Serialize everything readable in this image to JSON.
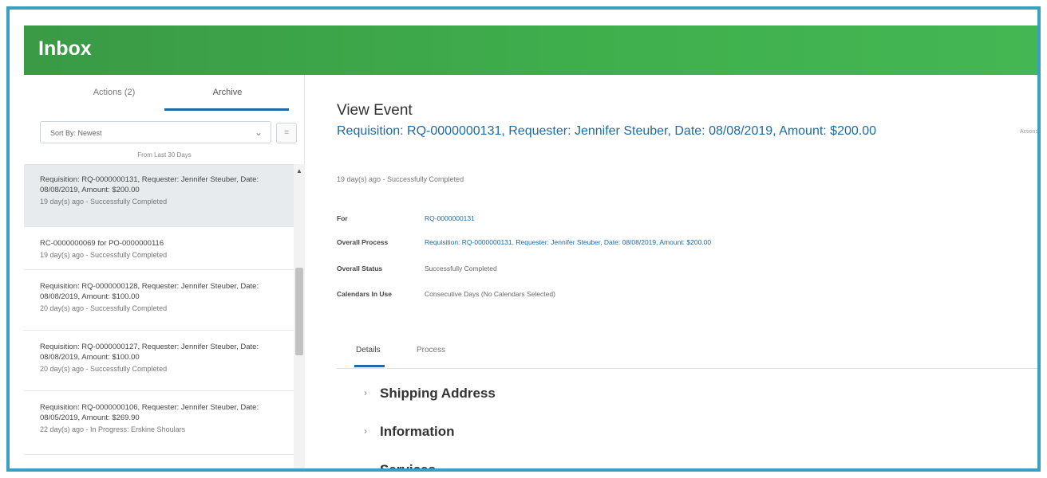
{
  "header": {
    "title": "Inbox"
  },
  "left": {
    "tabs": [
      {
        "label": "Actions (2)"
      },
      {
        "label": "Archive"
      }
    ],
    "sort": {
      "value": "Sort By: Newest"
    },
    "range_label": "From Last 30 Days",
    "items": [
      {
        "title": "Requisition: RQ-0000000131, Requester: Jennifer Steuber, Date: 08/08/2019, Amount: $200.00",
        "status": "19 day(s) ago - Successfully Completed"
      },
      {
        "title": "RC-0000000069 for PO-0000000116",
        "status": "19 day(s) ago - Successfully Completed"
      },
      {
        "title": "Requisition: RQ-0000000128, Requester: Jennifer Steuber, Date: 08/08/2019, Amount: $100.00",
        "status": "20 day(s) ago - Successfully Completed"
      },
      {
        "title": "Requisition: RQ-0000000127, Requester: Jennifer Steuber, Date: 08/08/2019, Amount: $100.00",
        "status": "20 day(s) ago - Successfully Completed"
      },
      {
        "title": "Requisition: RQ-0000000106, Requester: Jennifer Steuber, Date: 08/05/2019, Amount: $269.90",
        "status": "22 day(s) ago - In Progress: Erskine Shoulars"
      }
    ]
  },
  "main": {
    "title": "View Event",
    "event_link": "Requisition: RQ-0000000131, Requester: Jennifer Steuber, Date: 08/08/2019, Amount: $200.00",
    "actions_label": "Actions",
    "status_line": "19 day(s) ago - Successfully Completed",
    "fields": [
      {
        "label": "For",
        "value": "RQ-0000000131"
      },
      {
        "label": "Overall Process",
        "value": "Requisition: RQ-0000000131, Requester: Jennifer Steuber, Date: 08/08/2019, Amount: $200.00"
      },
      {
        "label": "Overall Status",
        "value": "Successfully Completed"
      },
      {
        "label": "Calendars In Use",
        "value": "Consecutive Days (No Calendars Selected)"
      }
    ],
    "detail_tabs": [
      {
        "label": "Details"
      },
      {
        "label": "Process"
      }
    ],
    "sections": [
      {
        "label": "Shipping Address",
        "icon": "chevron-right-icon"
      },
      {
        "label": "Information",
        "icon": "chevron-right-icon"
      },
      {
        "label": "Services",
        "icon": "chevron-down-icon"
      }
    ]
  },
  "colors": {
    "header_green": "#3fb04d",
    "link_blue": "#1d6aa5",
    "frame_border": "#3a9fc0"
  }
}
